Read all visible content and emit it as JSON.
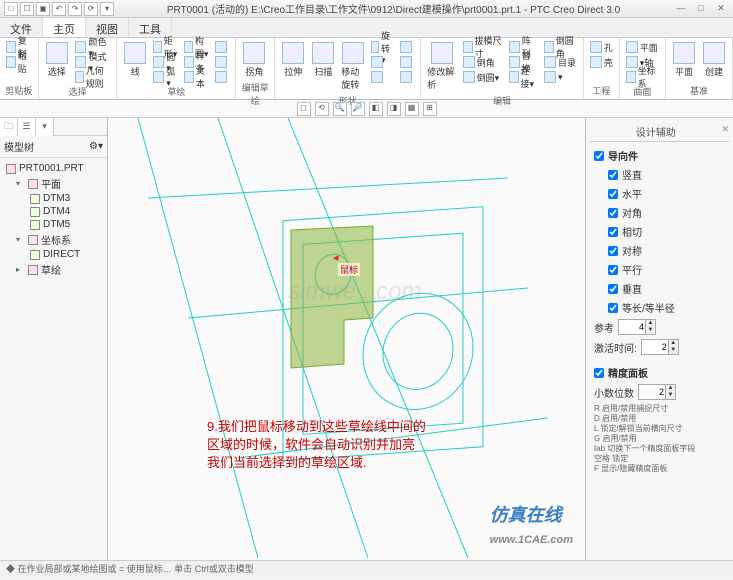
{
  "title": "PRT0001 (活动的) E:\\Creo工作目录\\工作文件\\0912\\Direct建模操作\\prt0001.prt.1 - PTC Creo Direct 3.0",
  "menu": {
    "tabs": [
      "文件",
      "主页",
      "视图",
      "工具"
    ],
    "active": 1
  },
  "ribbon": {
    "groups": [
      {
        "label": "剪贴板",
        "large": [],
        "cols": [
          [
            "复制",
            "粘贴"
          ]
        ]
      },
      {
        "label": "选择",
        "large": [
          {
            "label": "选择"
          }
        ],
        "cols": [
          [
            "颜色▾",
            "模式▾",
            "几何规则"
          ]
        ]
      },
      {
        "label": "草绘",
        "large": [
          {
            "label": "线"
          }
        ],
        "cols": [
          [
            "矩形▾",
            "圆▾",
            "弧▾"
          ],
          [
            "构图▾",
            "样条",
            "文本"
          ],
          [
            "",
            "",
            ""
          ]
        ]
      },
      {
        "label": "编辑草绘",
        "large": [
          {
            "label": "拐角"
          }
        ],
        "cols": []
      },
      {
        "label": "形状",
        "large": [
          {
            "label": "拉伸"
          },
          {
            "label": "扫描"
          },
          {
            "label": "移动旋转"
          }
        ],
        "cols": [
          [
            "旋转▾",
            "",
            ""
          ],
          [
            "",
            "",
            ""
          ]
        ]
      },
      {
        "label": "编辑",
        "large": [
          {
            "label": "修改解析"
          }
        ],
        "cols": [
          [
            "拔模尺寸",
            "倒角",
            "倒圆▾"
          ],
          [
            "阵列",
            "替换",
            "连接▾"
          ],
          [
            "倒圆角",
            "目录",
            "▾"
          ]
        ]
      },
      {
        "label": "工程",
        "large": [],
        "cols": [
          [
            "孔",
            "壳"
          ]
        ]
      },
      {
        "label": "曲面",
        "large": [],
        "cols": [
          [
            "平面",
            "▾轴",
            "坐标系"
          ]
        ]
      },
      {
        "label": "基准",
        "large": [
          {
            "label": "平面"
          },
          {
            "label": "创建"
          }
        ],
        "cols": []
      }
    ]
  },
  "subtoolbar": [
    "◻",
    "⟲",
    "🔍",
    "🔎",
    "◧",
    "◨",
    "▦",
    "⊞"
  ],
  "tree": {
    "header": "模型树",
    "root": "PRT0001.PRT",
    "nodes": [
      {
        "label": "平面",
        "exp": "▾",
        "children": [
          "DTM3",
          "DTM4",
          "DTM5"
        ]
      },
      {
        "label": "坐标系",
        "exp": "▾",
        "children": [
          "DIRECT"
        ]
      },
      {
        "label": "草绘",
        "exp": "▸",
        "children": []
      }
    ]
  },
  "rightpanel": {
    "title": "设计辅助",
    "guide_label": "导向件",
    "guides": [
      "竖直",
      "水平",
      "对角",
      "相切",
      "对称",
      "平行",
      "垂直",
      "等长/等半径"
    ],
    "ref_label": "参考",
    "ref_value": "4",
    "delay_label": "激活时间:",
    "delay_value": "2",
    "precision_label": "精度面板",
    "decimals_label": "小数位数",
    "decimals_value": "2",
    "keys": "R 启用/禁用捕捉尺寸\nD 启用/禁用\nL 锁定/解锁当前横向尺寸\nG 启用/禁用\ntab 切换下一个精度面板字段\n空格 锁定\nF 显示/隐藏精度面板"
  },
  "annotation": "9.我们把鼠标移动到这些草绘线中间的区域的时候，软件会自动识别并加亮我们当前选择到的草绘区域.",
  "cursor_label": "鼠标",
  "watermark": "simwe . com",
  "watermark2": "仿真在线",
  "watermark3": "www.1CAE.com",
  "statusbar": "◆ 在作业局部或某地绘图或 = 使用鼠标… 单击 Ctrl或双击模型"
}
